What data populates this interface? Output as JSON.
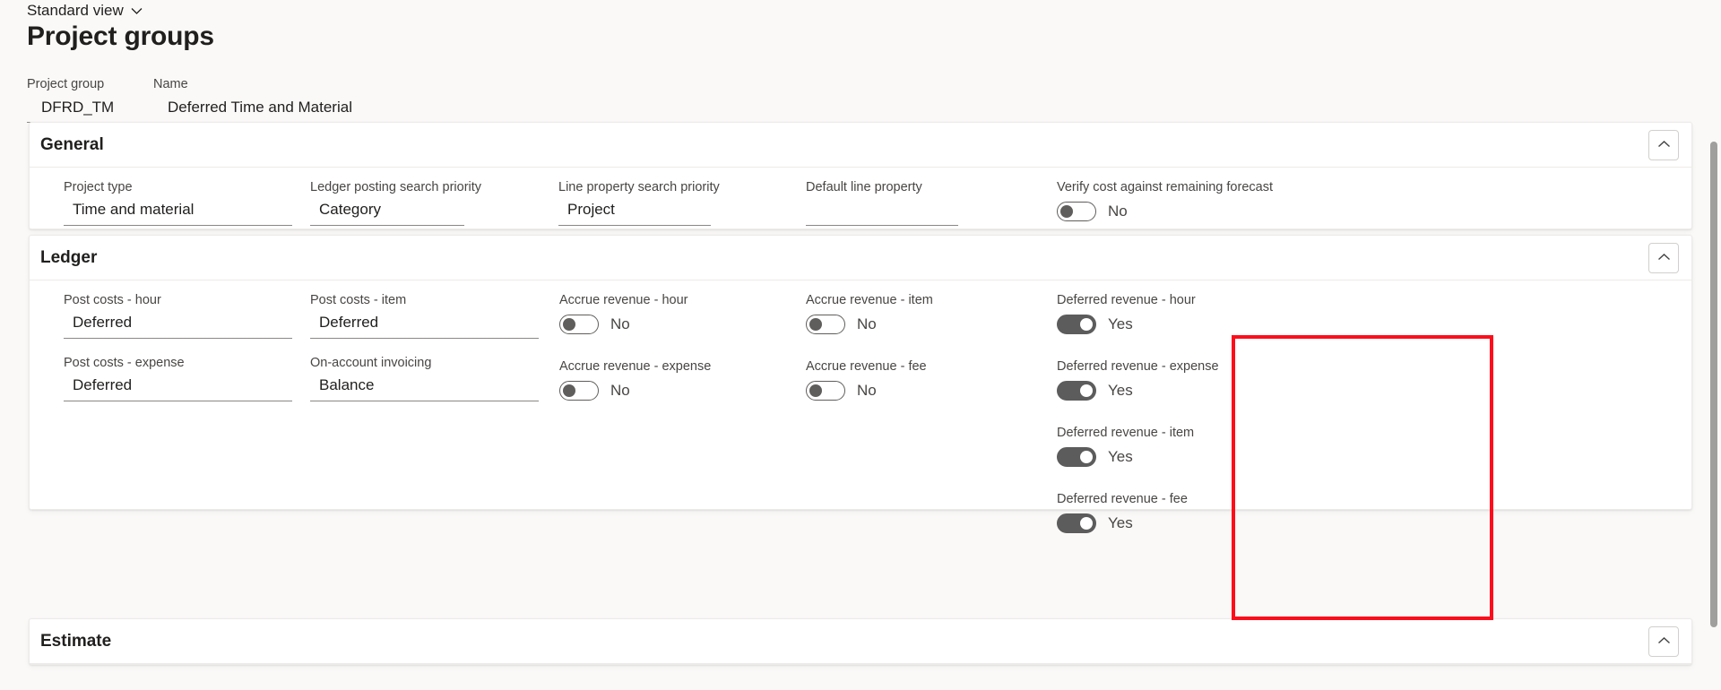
{
  "header": {
    "view_label": "Standard view",
    "view_chevron_icon": "chevron-down-icon",
    "title": "Project groups",
    "fields": [
      {
        "label": "Project group",
        "value": "DFRD_TM"
      },
      {
        "label": "Name",
        "value": "Deferred Time and Material"
      }
    ]
  },
  "sections": {
    "general": {
      "title": "General",
      "collapse_icon": "chevron-up-icon",
      "fields": [
        {
          "label": "Project type",
          "value": "Time and material"
        },
        {
          "label": "Ledger posting search priority",
          "value": "Category"
        },
        {
          "label": "Line property search priority",
          "value": "Project"
        },
        {
          "label": "Default line property",
          "value": ""
        }
      ],
      "toggles": [
        {
          "label": "Verify cost against remaining forecast",
          "state": "No",
          "on": false
        }
      ]
    },
    "ledger": {
      "title": "Ledger",
      "collapse_icon": "chevron-up-icon",
      "col1": [
        {
          "label": "Post costs - hour",
          "value": "Deferred"
        },
        {
          "label": "Post costs - expense",
          "value": "Deferred"
        }
      ],
      "col2": [
        {
          "label": "Post costs - item",
          "value": "Deferred"
        },
        {
          "label": "On-account invoicing",
          "value": "Balance"
        }
      ],
      "col3": [
        {
          "label": "Accrue revenue - hour",
          "state": "No",
          "on": false
        },
        {
          "label": "Accrue revenue - expense",
          "state": "No",
          "on": false
        }
      ],
      "col4": [
        {
          "label": "Accrue revenue - item",
          "state": "No",
          "on": false
        },
        {
          "label": "Accrue revenue - fee",
          "state": "No",
          "on": false
        }
      ],
      "col5": [
        {
          "label": "Deferred revenue - hour",
          "state": "Yes",
          "on": true
        },
        {
          "label": "Deferred revenue - expense",
          "state": "Yes",
          "on": true
        },
        {
          "label": "Deferred revenue - item",
          "state": "Yes",
          "on": true
        },
        {
          "label": "Deferred revenue - fee",
          "state": "Yes",
          "on": true
        }
      ]
    },
    "estimate": {
      "title": "Estimate",
      "collapse_icon": "chevron-up-icon"
    }
  },
  "annotation": {
    "highlight_color": "#fc0d1b"
  },
  "scrollbar": {
    "orientation": "vertical"
  }
}
